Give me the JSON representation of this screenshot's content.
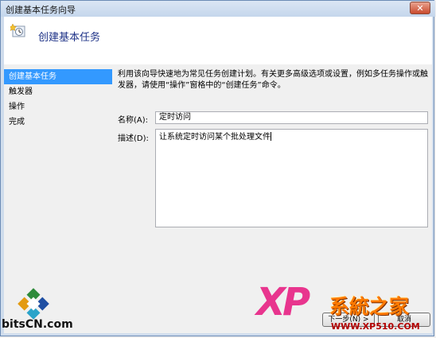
{
  "window": {
    "title": "创建基本任务向导",
    "close_glyph": "✕"
  },
  "header": {
    "title": "创建基本任务",
    "icon": "task-clock-icon"
  },
  "sidebar": {
    "items": [
      {
        "label": "创建基本任务",
        "active": true
      },
      {
        "label": "触发器",
        "active": false
      },
      {
        "label": "操作",
        "active": false
      },
      {
        "label": "完成",
        "active": false
      }
    ]
  },
  "content": {
    "description": "利用该向导快速地为常见任务创建计划。有关更多高级选项或设置，例如多任务操作或触发器，请使用“操作”窗格中的“创建任务”命令。",
    "name_label": "名称(A):",
    "name_value": "定时访问",
    "description_label": "描述(D):",
    "description_value": "让系统定时访问某个批处理文件"
  },
  "buttons": {
    "next_label": "下一步(N) >",
    "cancel_label": "取消"
  },
  "watermarks": {
    "left_text": "bitsCN.com",
    "right_brand": "XP",
    "right_title": "系統之家",
    "right_url": "WWW.XP510.COM"
  },
  "colors": {
    "selection": "#3399ff",
    "header_title": "#1e3287",
    "window_frame": "#cfdcec"
  }
}
